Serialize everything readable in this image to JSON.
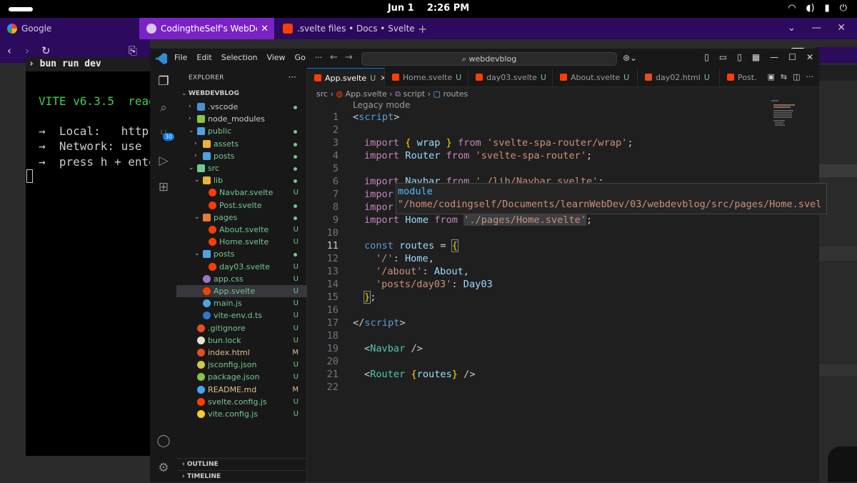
{
  "system": {
    "date": "Jun 1",
    "time": "2:26 PM"
  },
  "browser": {
    "tabs": [
      {
        "label": "Google"
      },
      {
        "label": "CodingtheSelf's WebDevBl"
      },
      {
        "label": ".svelte files • Docs • Svelte"
      }
    ]
  },
  "terminal": {
    "title": "bun run dev",
    "lines": [
      "VITE v6.3.5  read",
      "→  Local:   http:",
      "→  Network: use -",
      "→  press h + ente"
    ]
  },
  "vscode": {
    "menu": [
      "File",
      "Edit",
      "Selection",
      "View",
      "Go",
      "···"
    ],
    "search_value": "webdevblog",
    "explorer_title": "EXPLORER",
    "project": "WEBDEVBLOG",
    "tree": [
      {
        "name": ".vscode",
        "status": ""
      },
      {
        "name": "node_modules",
        "status": ""
      },
      {
        "name": "public",
        "status": ""
      },
      {
        "name": "assets",
        "status": ""
      },
      {
        "name": "posts",
        "status": ""
      },
      {
        "name": "src",
        "status": ""
      },
      {
        "name": "lib",
        "status": ""
      },
      {
        "name": "Navbar.svelte",
        "status": "U"
      },
      {
        "name": "Post.svelte",
        "status": ""
      },
      {
        "name": "pages",
        "status": ""
      },
      {
        "name": "About.svelte",
        "status": "U"
      },
      {
        "name": "Home.svelte",
        "status": "U"
      },
      {
        "name": "posts",
        "status": ""
      },
      {
        "name": "day03.svelte",
        "status": "U"
      },
      {
        "name": "app.css",
        "status": "U"
      },
      {
        "name": "App.svelte",
        "status": "U"
      },
      {
        "name": "main.js",
        "status": "U"
      },
      {
        "name": "vite-env.d.ts",
        "status": "U"
      },
      {
        "name": ".gitignore",
        "status": "U"
      },
      {
        "name": "bun.lock",
        "status": "U"
      },
      {
        "name": "index.html",
        "status": "M"
      },
      {
        "name": "jsconfig.json",
        "status": "U"
      },
      {
        "name": "package.json",
        "status": "U"
      },
      {
        "name": "README.md",
        "status": "M"
      },
      {
        "name": "svelte.config.js",
        "status": "U"
      },
      {
        "name": "vite.config.js",
        "status": "U"
      }
    ],
    "outline_label": "OUTLINE",
    "timeline_label": "TIMELINE",
    "scm_badge": "30",
    "editor_tabs": [
      {
        "label": "App.svelte",
        "status": "U"
      },
      {
        "label": "Home.svelte",
        "status": "U"
      },
      {
        "label": "day03.svelte",
        "status": "U"
      },
      {
        "label": "About.svelte",
        "status": "U"
      },
      {
        "label": "day02.html",
        "status": "U"
      },
      {
        "label": "Post.",
        "status": ""
      }
    ],
    "breadcrumb": {
      "a": "src",
      "b": "App.svelte",
      "c": "script",
      "d": "routes"
    },
    "legacy_mode": "Legacy mode",
    "hover": {
      "kind": "module",
      "path": "\"/home/codingself/Documents/learnWebDev/03/webdevblog/src/pages/Home.svel"
    },
    "line_numbers": [
      "1",
      "2",
      "3",
      "4",
      "5",
      "6",
      "7",
      "8",
      "9",
      "10",
      "11",
      "12",
      "13",
      "14",
      "15",
      "16",
      "17",
      "18",
      "19",
      "20",
      "21",
      "22"
    ],
    "code": {
      "l1_tag": "script",
      "l3_src": "'svelte-spa-router/wrap'",
      "l4_src": "'svelte-spa-router'",
      "l6_partial": "import Navbar from './lib/Navbar.svelte';",
      "l9_src": "'./pages/Home.svelte'",
      "r1_key": "'/'",
      "r1_val": "Home",
      "r2_key": "'/about'",
      "r2_val": "About",
      "r3_key": "'posts/day03'",
      "r3_val": "Day03"
    }
  },
  "colors": {
    "browser_tabbar": "#2c0a5e",
    "active_tab": "#7a22c7",
    "vscode_bg": "#1f1f1f",
    "vite_green": "#3fd14c",
    "untracked": "#73c991",
    "modified": "#e2c08d"
  }
}
